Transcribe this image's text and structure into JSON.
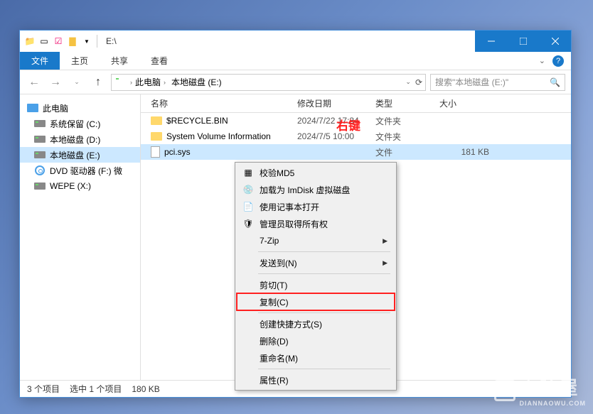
{
  "titlebar": {
    "title": "E:\\"
  },
  "ribbon": {
    "file": "文件",
    "tabs": [
      "主页",
      "共享",
      "查看"
    ]
  },
  "address": {
    "segments": [
      "此电脑",
      "本地磁盘 (E:)"
    ]
  },
  "search": {
    "placeholder": "搜索\"本地磁盘 (E:)\""
  },
  "sidebar": {
    "root": "此电脑",
    "items": [
      {
        "label": "系统保留 (C:)",
        "icon": "drive"
      },
      {
        "label": "本地磁盘 (D:)",
        "icon": "drive"
      },
      {
        "label": "本地磁盘 (E:)",
        "icon": "drive",
        "selected": true
      },
      {
        "label": "DVD 驱动器 (F:) 微",
        "icon": "cd"
      },
      {
        "label": "WEPE (X:)",
        "icon": "drive"
      }
    ]
  },
  "columns": {
    "name": "名称",
    "date": "修改日期",
    "type": "类型",
    "size": "大小"
  },
  "rows": [
    {
      "name": "$RECYCLE.BIN",
      "date": "2024/7/22 17:34",
      "type": "文件夹",
      "size": "",
      "icon": "folder"
    },
    {
      "name": "System Volume Information",
      "date": "2024/7/5 10:00",
      "type": "文件夹",
      "size": "",
      "icon": "folder"
    },
    {
      "name": "pci.sys",
      "date": "",
      "type": "文件",
      "size": "181 KB",
      "icon": "file",
      "selected": true
    }
  ],
  "annotation": "右键",
  "context_menu": {
    "items": [
      {
        "label": "校验MD5",
        "icon": "checksum"
      },
      {
        "label": "加载为 ImDisk 虚拟磁盘",
        "icon": "disk"
      },
      {
        "label": "使用记事本打开",
        "icon": "notepad"
      },
      {
        "label": "管理员取得所有权",
        "icon": "shield"
      },
      {
        "label": "7-Zip",
        "submenu": true
      },
      {
        "sep": true
      },
      {
        "label": "发送到(N)",
        "submenu": true
      },
      {
        "sep": true
      },
      {
        "label": "剪切(T)"
      },
      {
        "label": "复制(C)",
        "highlight": true
      },
      {
        "sep": true
      },
      {
        "label": "创建快捷方式(S)"
      },
      {
        "label": "删除(D)"
      },
      {
        "label": "重命名(M)"
      },
      {
        "sep": true
      },
      {
        "label": "属性(R)"
      }
    ]
  },
  "statusbar": {
    "count": "3 个项目",
    "selection": "选中 1 个项目",
    "size": "180 KB"
  },
  "watermark": {
    "text": "电脑屋",
    "sub": "DIANNAOWU.COM"
  }
}
